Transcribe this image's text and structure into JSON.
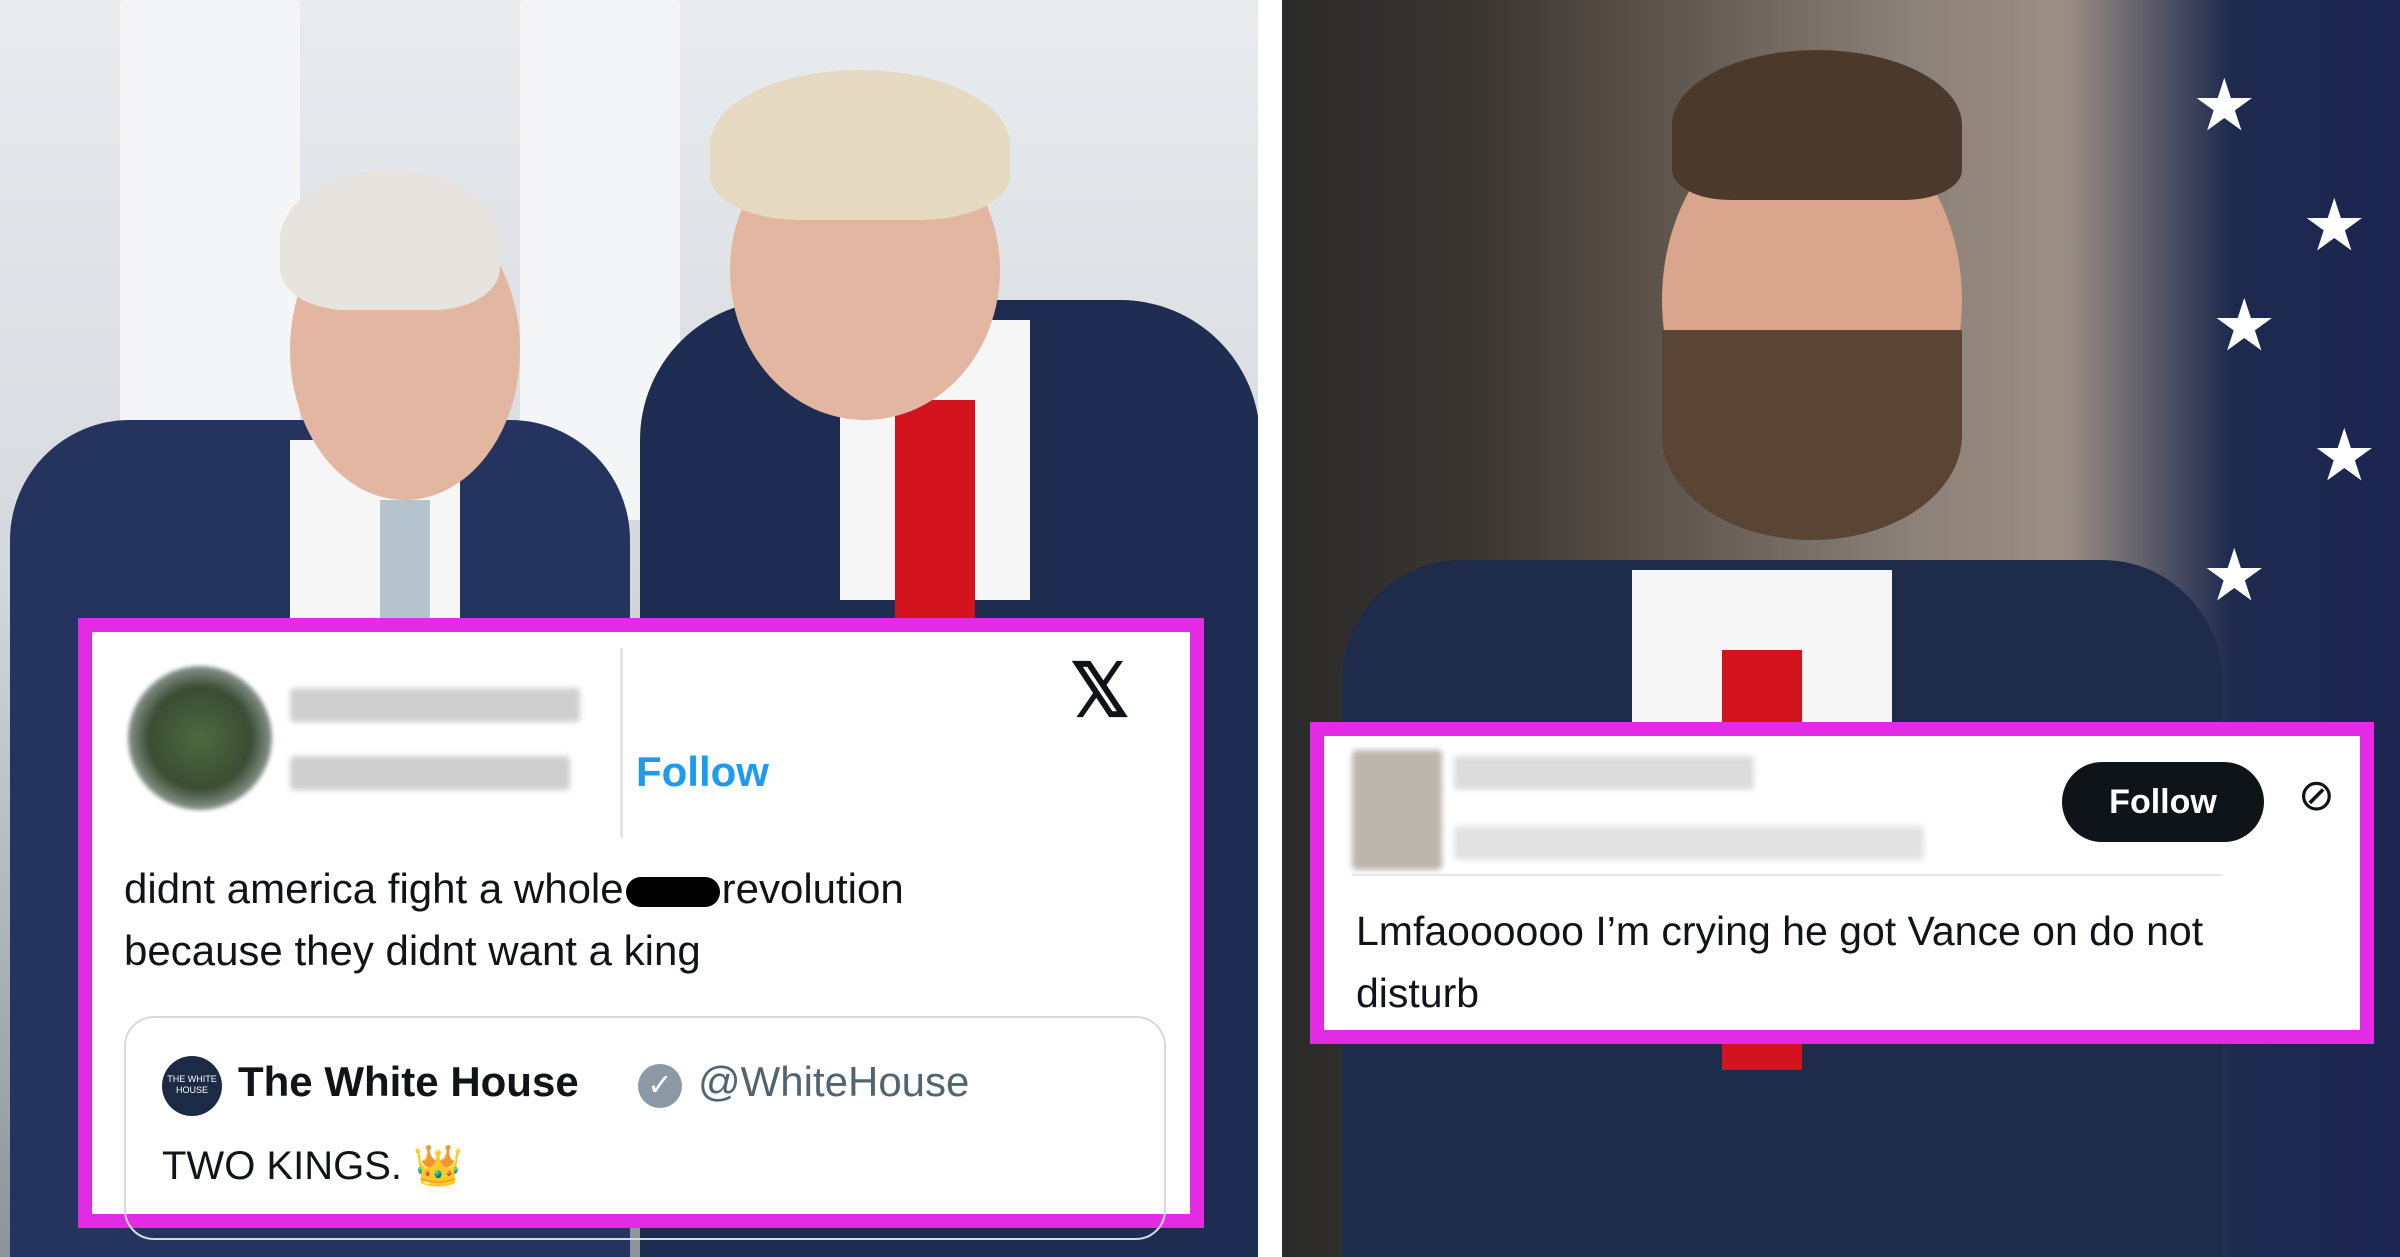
{
  "left_tweet": {
    "follow_label": "Follow",
    "platform_icon": "x-logo",
    "platform_glyph": "𝕏",
    "text_part1": "didnt america fight a whole",
    "text_part2": "revolution",
    "text_line2": "because they didnt want a king",
    "quote": {
      "logo_text": "THE WHITE HOUSE",
      "name": "The White House",
      "verified_glyph": "✓",
      "handle": "@WhiteHouse",
      "text": "TWO KINGS. 👑"
    }
  },
  "right_tweet": {
    "follow_label": "Follow",
    "mute_icon": "⊘",
    "text_line1": "Lmfaoooooo I’m crying he got Vance on do not",
    "text_line2": "disturb"
  },
  "colors": {
    "card_border": "#e32be5",
    "link_blue": "#1d9bf0",
    "text": "#0f1419"
  },
  "flag_star": "★"
}
